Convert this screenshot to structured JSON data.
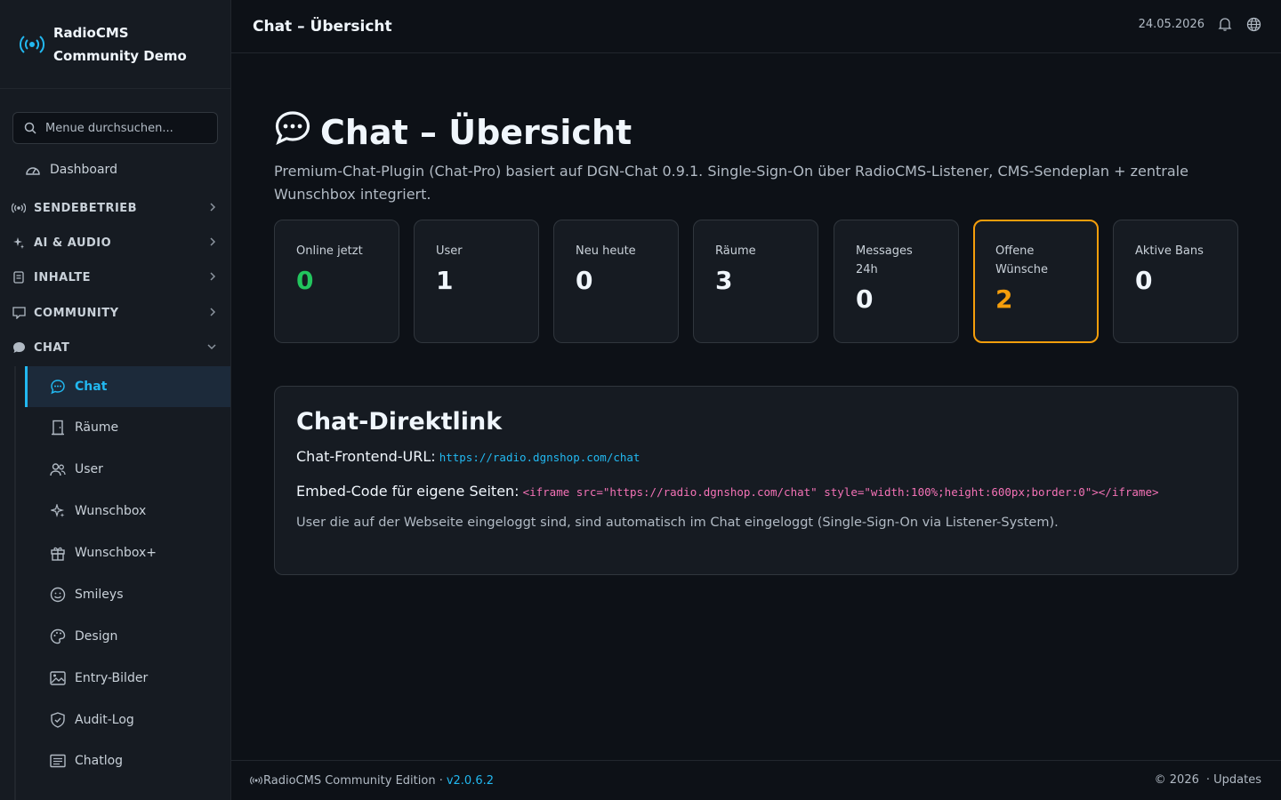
{
  "colors": {
    "accent": "#22b8f0",
    "green": "#22c55e",
    "orange": "#f59e0b",
    "pink": "#f472b6"
  },
  "brand": {
    "line1": "RadioCMS",
    "line2": "Community Demo",
    "icon": "radio-broadcast-icon"
  },
  "search": {
    "placeholder": "Menue durchsuchen..."
  },
  "nav": {
    "dashboard": "Dashboard",
    "sections": [
      {
        "label": "SENDEBETRIEB",
        "icon": "broadcast-icon"
      },
      {
        "label": "AI & AUDIO",
        "icon": "sparkle-icon"
      },
      {
        "label": "INHALTE",
        "icon": "document-icon"
      },
      {
        "label": "COMMUNITY",
        "icon": "comment-icon"
      },
      {
        "label": "CHAT",
        "icon": "chat-bubble-icon"
      }
    ],
    "chat_items": [
      {
        "label": "Chat",
        "icon": "chat-icon"
      },
      {
        "label": "Räume",
        "icon": "door-icon"
      },
      {
        "label": "User",
        "icon": "users-icon"
      },
      {
        "label": "Wunschbox",
        "icon": "sparkle-icon"
      },
      {
        "label": "Wunschbox+",
        "icon": "gift-icon"
      },
      {
        "label": "Smileys",
        "icon": "smiley-icon"
      },
      {
        "label": "Design",
        "icon": "palette-icon"
      },
      {
        "label": "Entry-Bilder",
        "icon": "image-icon"
      },
      {
        "label": "Audit-Log",
        "icon": "shield-icon"
      },
      {
        "label": "Chatlog",
        "icon": "list-icon"
      }
    ]
  },
  "topbar": {
    "title": "Chat – Übersicht",
    "date": "24.05.2026"
  },
  "page": {
    "title": "Chat – Übersicht",
    "description": "Premium-Chat-Plugin (Chat-Pro) basiert auf DGN-Chat 0.9.1. Single-Sign-On über RadioCMS-Listener, CMS-Sendeplan + zentrale Wunschbox integriert."
  },
  "stats": [
    {
      "label": "Online jetzt",
      "value": "0"
    },
    {
      "label": "User",
      "value": "1"
    },
    {
      "label": "Neu heute",
      "value": "0"
    },
    {
      "label": "Räume",
      "value": "3"
    },
    {
      "label": "Messages 24h",
      "value": "0"
    },
    {
      "label": "Offene Wünsche",
      "value": "2"
    },
    {
      "label": "Aktive Bans",
      "value": "0"
    }
  ],
  "direct_link": {
    "title": "Chat-Direktlink",
    "url_label": "Chat-Frontend-URL:",
    "url": "https://radio.dgnshop.com/chat",
    "embed_label": "Embed-Code für eigene Seiten:",
    "embed_code": "<iframe src=\"https://radio.dgnshop.com/chat\" style=\"width:100%;height:600px;border:0\"></iframe>",
    "note": "User die auf der Webseite eingeloggt sind, sind automatisch im Chat eingeloggt (Single-Sign-On via Listener-System)."
  },
  "footer": {
    "edition": "RadioCMS Community Edition ·",
    "version": "v2.0.6.2",
    "copyright": "© 2026",
    "updates": "· Updates"
  }
}
